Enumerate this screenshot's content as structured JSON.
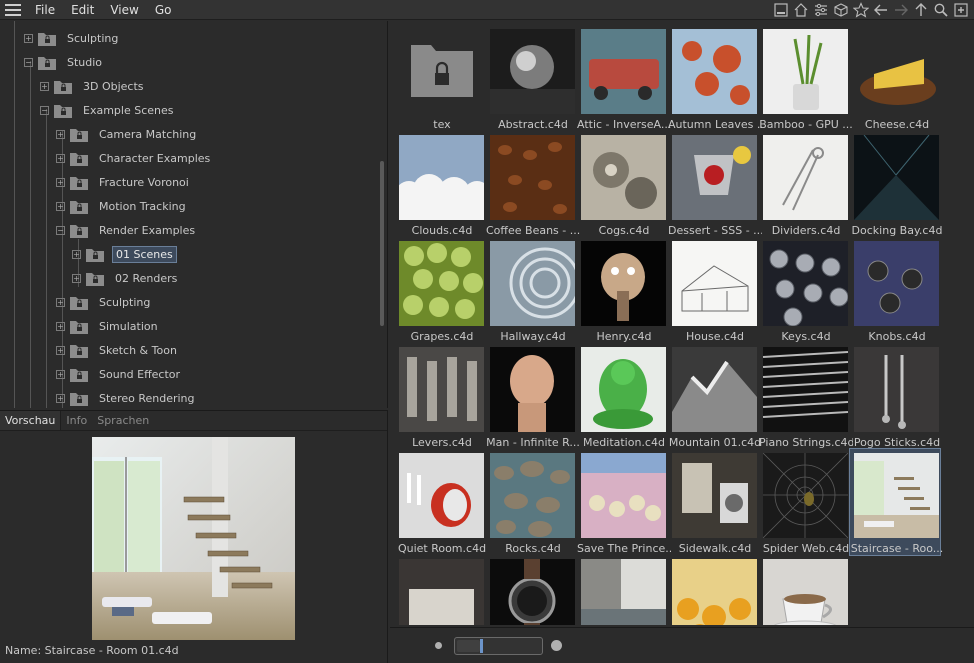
{
  "menu": {
    "items": [
      "File",
      "Edit",
      "View",
      "Go"
    ]
  },
  "toolbar": {
    "icons": [
      "minimize-panel-icon",
      "home-icon",
      "filter-icon",
      "cube-icon",
      "star-icon",
      "back-arrow-icon",
      "forward-arrow-icon",
      "up-arrow-icon",
      "search-icon",
      "new-folder-icon"
    ]
  },
  "tree": {
    "items": [
      {
        "label": "Sculpting",
        "level": 1,
        "expanded": false
      },
      {
        "label": "Studio",
        "level": 1,
        "expanded": true
      },
      {
        "label": "3D Objects",
        "level": 2,
        "expanded": false
      },
      {
        "label": "Example Scenes",
        "level": 2,
        "expanded": true
      },
      {
        "label": "Camera Matching",
        "level": 3,
        "expanded": false
      },
      {
        "label": "Character Examples",
        "level": 3,
        "expanded": false
      },
      {
        "label": "Fracture Voronoi",
        "level": 3,
        "expanded": false
      },
      {
        "label": "Motion Tracking",
        "level": 3,
        "expanded": false
      },
      {
        "label": "Render Examples",
        "level": 3,
        "expanded": true
      },
      {
        "label": "01 Scenes",
        "level": 4,
        "expanded": false,
        "selected": true
      },
      {
        "label": "02 Renders",
        "level": 4,
        "expanded": false
      },
      {
        "label": "Sculpting",
        "level": 3,
        "expanded": false
      },
      {
        "label": "Simulation",
        "level": 3,
        "expanded": false
      },
      {
        "label": "Sketch & Toon",
        "level": 3,
        "expanded": false
      },
      {
        "label": "Sound Effector",
        "level": 3,
        "expanded": false
      },
      {
        "label": "Stereo Rendering",
        "level": 3,
        "expanded": false
      }
    ]
  },
  "preview": {
    "tabs": [
      "Vorschau",
      "Info",
      "Sprachen"
    ],
    "active_tab": "Vorschau",
    "name_label": "Name:",
    "name_value": "Staircase - Room 01.c4d"
  },
  "grid": {
    "items": [
      {
        "label": "tex",
        "kind": "folder"
      },
      {
        "label": "Abstract.c4d"
      },
      {
        "label": "Attic - InverseA..."
      },
      {
        "label": "Autumn Leaves ..."
      },
      {
        "label": "Bamboo - GPU ..."
      },
      {
        "label": "Cheese.c4d"
      },
      {
        "label": "Clouds.c4d"
      },
      {
        "label": "Coffee Beans - ..."
      },
      {
        "label": "Cogs.c4d"
      },
      {
        "label": "Dessert - SSS - ..."
      },
      {
        "label": "Dividers.c4d"
      },
      {
        "label": "Docking Bay.c4d"
      },
      {
        "label": "Grapes.c4d"
      },
      {
        "label": "Hallway.c4d"
      },
      {
        "label": "Henry.c4d"
      },
      {
        "label": "House.c4d"
      },
      {
        "label": "Keys.c4d"
      },
      {
        "label": "Knobs.c4d"
      },
      {
        "label": "Levers.c4d"
      },
      {
        "label": "Man - Infinite R..."
      },
      {
        "label": "Meditation.c4d"
      },
      {
        "label": "Mountain 01.c4d"
      },
      {
        "label": "Piano Strings.c4d"
      },
      {
        "label": "Pogo Sticks.c4d"
      },
      {
        "label": "Quiet Room.c4d"
      },
      {
        "label": "Rocks.c4d"
      },
      {
        "label": "Save The Prince..."
      },
      {
        "label": "Sidewalk.c4d"
      },
      {
        "label": "Spider Web.c4d"
      },
      {
        "label": "Staircase - Roo...",
        "selected": true
      },
      {
        "label": ""
      },
      {
        "label": ""
      },
      {
        "label": ""
      },
      {
        "label": ""
      },
      {
        "label": ""
      }
    ]
  },
  "zoom": {
    "level_fraction": 0.28
  },
  "colors": {
    "selection_bg": "#3d4a5c",
    "selection_border": "#6a7f99",
    "panel_bg": "#2b2b2b",
    "zoom_handle": "#6c94c9"
  }
}
